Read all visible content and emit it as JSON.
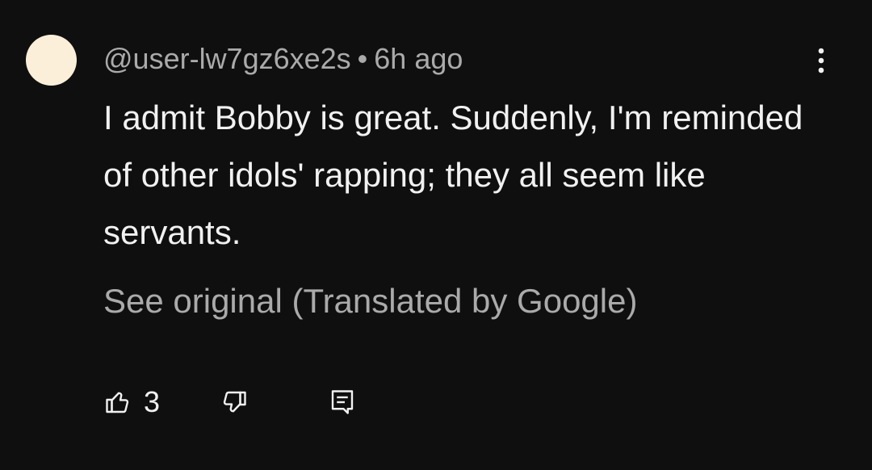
{
  "comment": {
    "author": "@user-lw7gz6xe2s",
    "separator": "•",
    "time": "6h ago",
    "text": "I admit Bobby is great. Suddenly, I'm reminded of other idols' rapping; they all seem like servants.",
    "see_original": "See original (Translated by Google)",
    "like_count": "3",
    "avatar_color": "#fcefd9"
  },
  "icons": {
    "more": "more-vertical-icon",
    "like": "thumbs-up-icon",
    "dislike": "thumbs-down-icon",
    "reply": "reply-comment-icon"
  },
  "colors": {
    "background": "#0f0f0f",
    "primary_text": "#f1f1f1",
    "secondary_text": "#aaaaaa"
  }
}
